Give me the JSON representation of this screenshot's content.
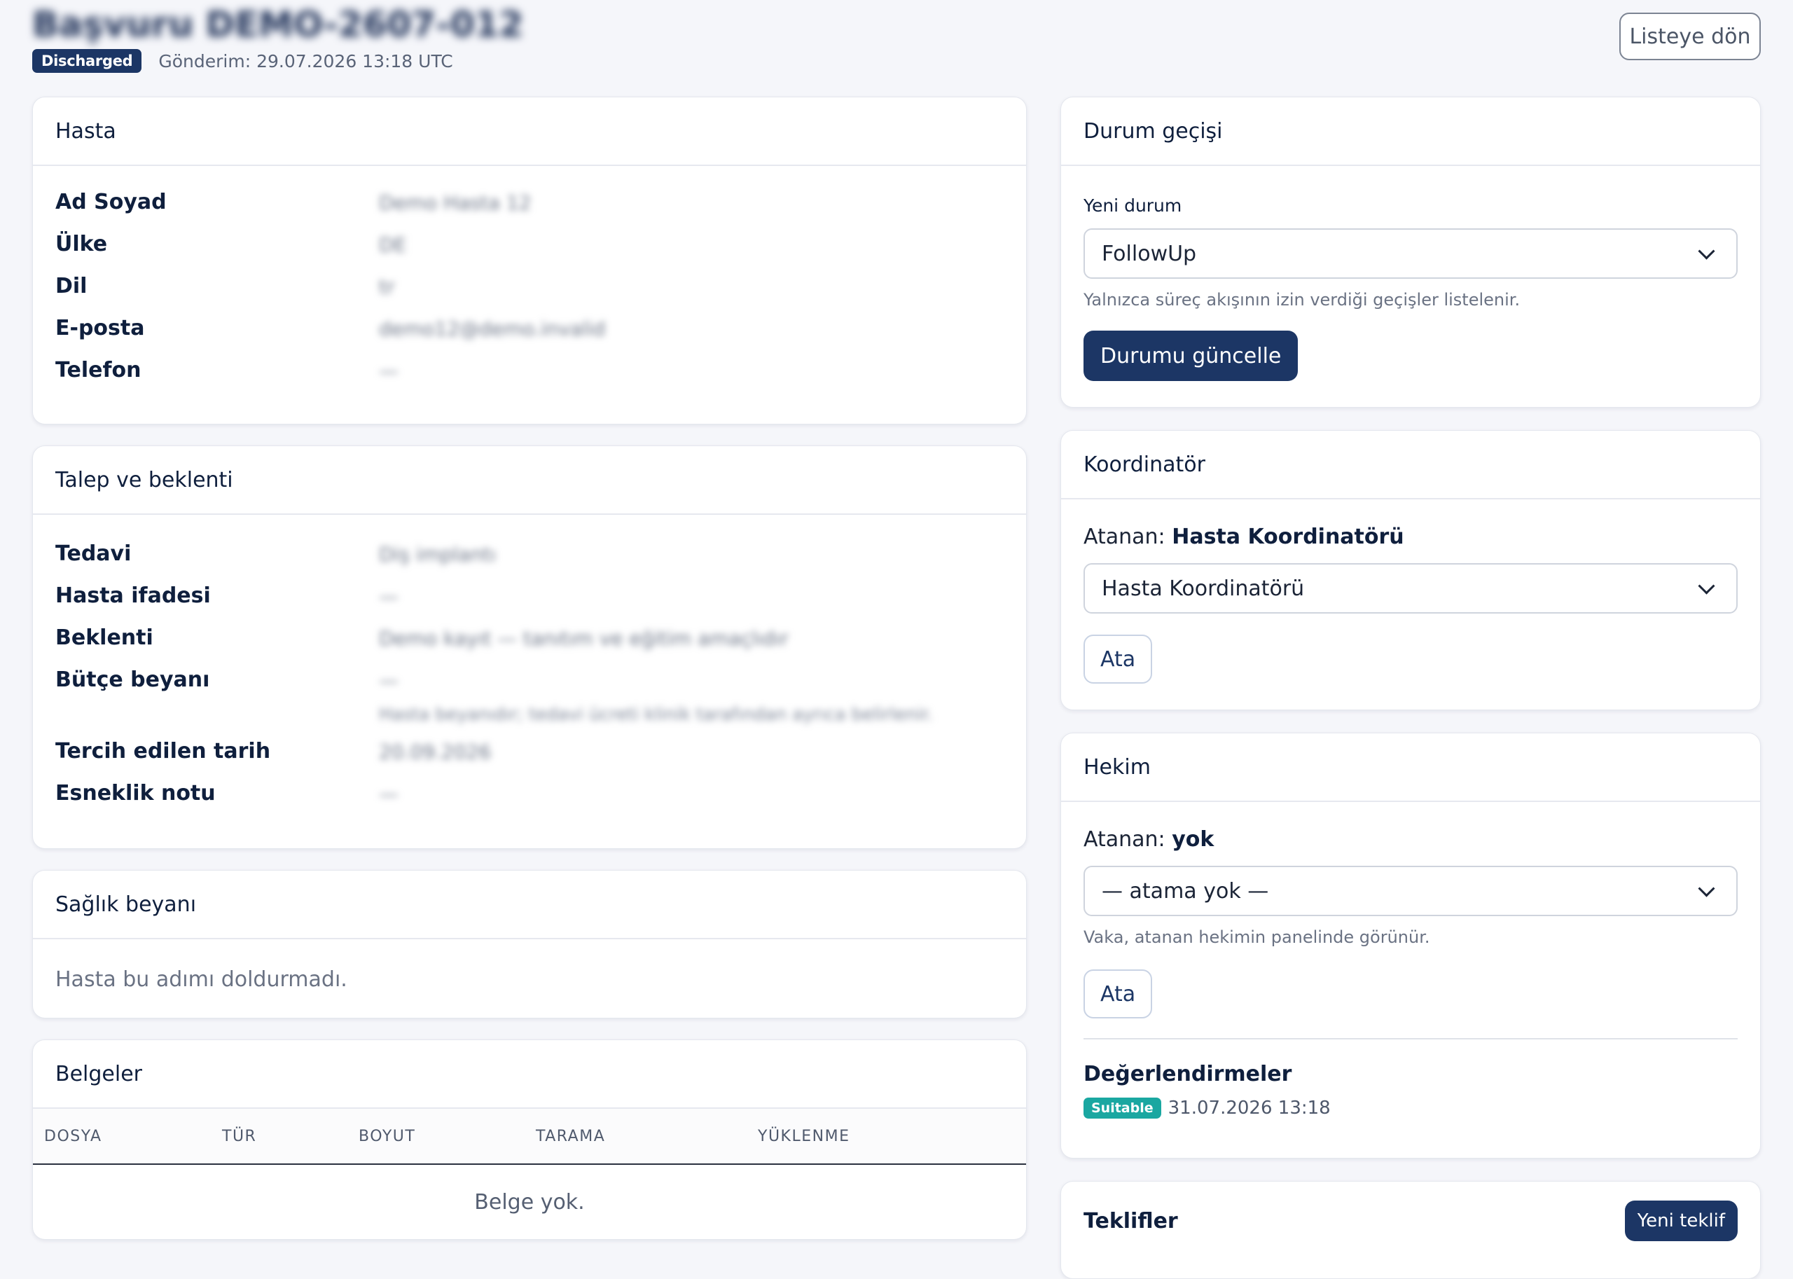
{
  "header": {
    "title_blurred": "Başvuru DEMO-2607-012",
    "status": "Discharged",
    "submitted": "Gönderim: 29.07.2026 13:18 UTC",
    "back_label": "Listeye dön"
  },
  "patient": {
    "title": "Hasta",
    "rows": [
      {
        "label": "Ad Soyad",
        "value": "Demo Hasta 12"
      },
      {
        "label": "Ülke",
        "value": "DE"
      },
      {
        "label": "Dil",
        "value": "tr"
      },
      {
        "label": "E-posta",
        "value": "demo12@demo.invalid"
      },
      {
        "label": "Telefon",
        "value": "—"
      }
    ]
  },
  "request": {
    "title": "Talep ve beklenti",
    "rows": [
      {
        "label": "Tedavi",
        "value": "Diş implantı"
      },
      {
        "label": "Hasta ifadesi",
        "value": "—"
      },
      {
        "label": "Beklenti",
        "value": "Demo kayıt — tanıtım ve eğitim amaçlıdır"
      },
      {
        "label": "Bütçe beyanı",
        "value": "—"
      }
    ],
    "budget_note": "Hasta beyanıdır; tedavi ücreti klinik tarafından ayrıca belirlenir.",
    "rows2": [
      {
        "label": "Tercih edilen tarih",
        "value": "20.09.2026"
      },
      {
        "label": "Esneklik notu",
        "value": "—"
      }
    ]
  },
  "health": {
    "title": "Sağlık beyanı",
    "empty": "Hasta bu adımı doldurmadı."
  },
  "documents": {
    "title": "Belgeler",
    "columns": [
      "DOSYA",
      "TÜR",
      "BOYUT",
      "TARAMA",
      "YÜKLENME"
    ],
    "empty": "Belge yok."
  },
  "status_transition": {
    "title": "Durum geçişi",
    "label": "Yeni durum",
    "selected": "FollowUp",
    "hint": "Yalnızca süreç akışının izin verdiği geçişler listelenir.",
    "button": "Durumu güncelle"
  },
  "coordinator": {
    "title": "Koordinatör",
    "assigned_prefix": "Atanan:",
    "assigned_name": "Hasta Koordinatörü",
    "selected": "Hasta Koordinatörü",
    "button": "Ata"
  },
  "physician": {
    "title": "Hekim",
    "assigned_prefix": "Atanan:",
    "assigned_name": "yok",
    "selected": "— atama yok —",
    "hint": "Vaka, atanan hekimin panelinde görünür.",
    "button": "Ata",
    "evaluations_title": "Değerlendirmeler",
    "evaluation_badge": "Suitable",
    "evaluation_date": "31.07.2026 13:18"
  },
  "offers": {
    "title": "Teklifler",
    "button": "Yeni teklif"
  },
  "colors": {
    "primary": "#1c3665",
    "success": "#1aa7a1",
    "background": "#f5f6fa"
  }
}
